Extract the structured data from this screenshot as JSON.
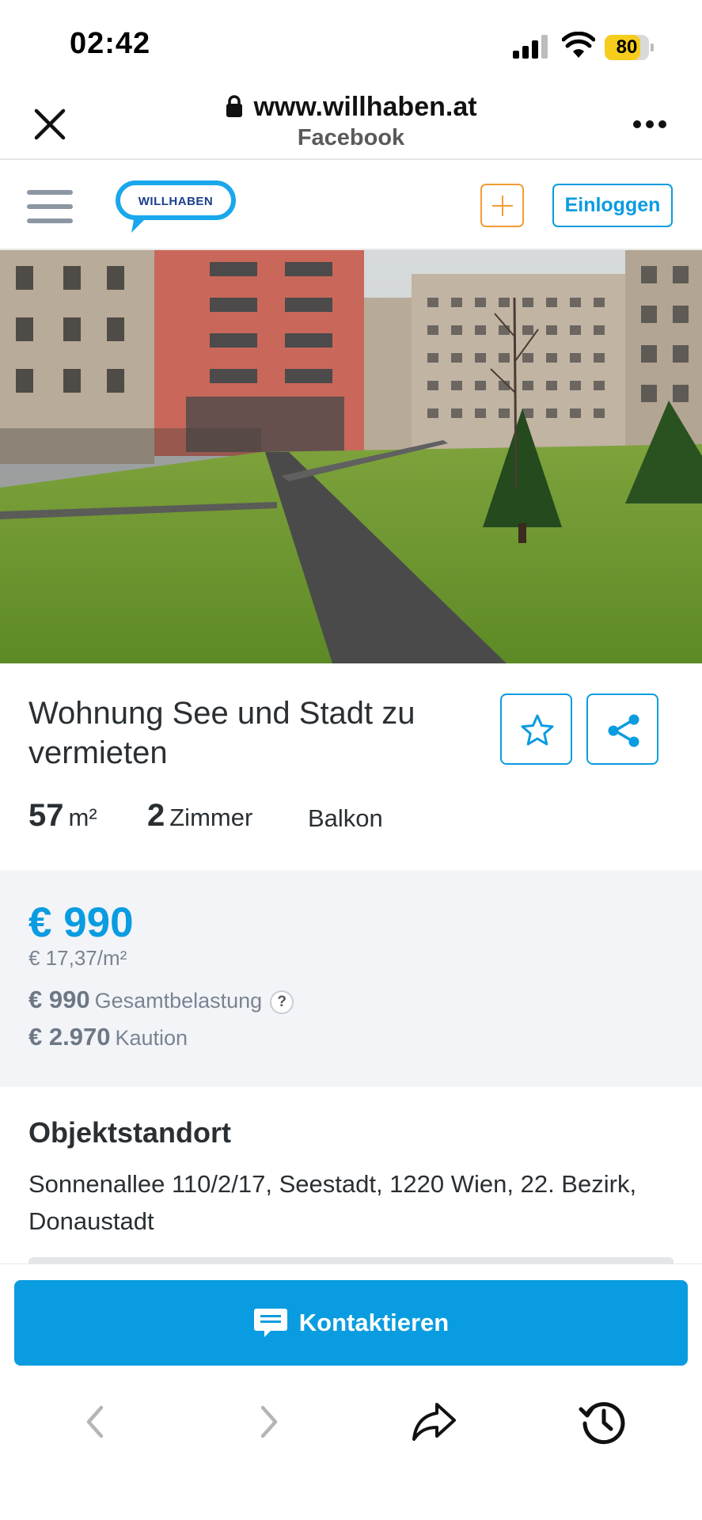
{
  "status_bar": {
    "time": "02:42",
    "battery": "80",
    "battery_level": 0.8
  },
  "browser": {
    "url": "www.willhaben.at",
    "subtitle": "Facebook"
  },
  "site_header": {
    "logo_text": "WILLHABEN",
    "login_label": "Einloggen"
  },
  "listing": {
    "title": "Wohnung See und Stadt zu vermieten",
    "facts": {
      "area_value": "57",
      "area_unit": "m²",
      "rooms_value": "2",
      "rooms_label": "Zimmer",
      "balcony": "Balkon"
    },
    "price": {
      "main": "€ 990",
      "per_sqm": "€ 17,37/m²",
      "total_value": "€ 990",
      "total_label": "Gesamtbelastung",
      "help": "?",
      "deposit_value": "€ 2.970",
      "deposit_label": "Kaution"
    },
    "location": {
      "heading": "Objektstandort",
      "address": "Sonnenallee 110/2/17, Seestadt, 1220 Wien, 22. Bezirk, Donaustadt"
    }
  },
  "contact": {
    "label": "Kontaktieren"
  },
  "colors": {
    "accent": "#0a9ce0",
    "add_button": "#f39c34",
    "price_panel_bg": "#f2f4f8"
  },
  "icons": [
    "close-icon",
    "lock-icon",
    "more-icon",
    "menu-icon",
    "plus-icon",
    "star-icon",
    "share-icon",
    "help-icon",
    "chat-icon",
    "back-icon",
    "forward-icon",
    "share-arrow-icon",
    "history-icon"
  ]
}
